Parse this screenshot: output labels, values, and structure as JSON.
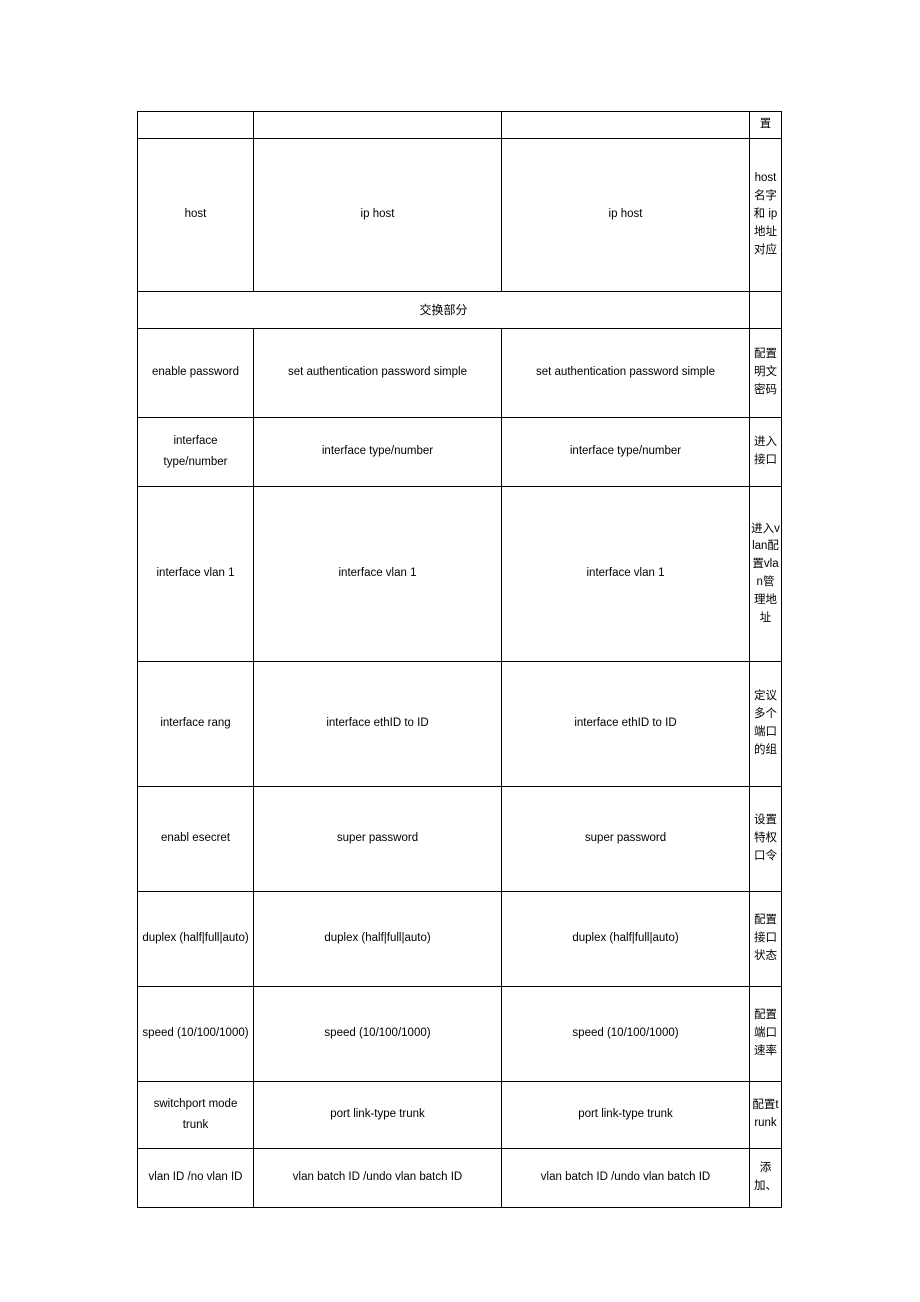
{
  "document": {
    "type": "command-comparison-table",
    "section_label": "交换部分"
  },
  "table": {
    "rows": [
      {
        "name": "partial-top-row",
        "cmd": "",
        "col2": "",
        "col3": "",
        "desc": "置"
      },
      {
        "name": "host-row",
        "cmd": "host",
        "col2": "ip host",
        "col3": "ip host",
        "desc": "host 名字和 ip 地址对应"
      },
      {
        "name": "section-divider",
        "section": true,
        "label": "交换部分"
      },
      {
        "name": "enable-password-row",
        "cmd": "enable password",
        "col2": "set authentication  password simple",
        "col3": "set authentication  password simple",
        "desc": "配置明文密码"
      },
      {
        "name": "interface-type-row",
        "cmd": "interface type/number",
        "col2": "interface type/number",
        "col3": "interface type/number",
        "desc": "进入接口"
      },
      {
        "name": "interface-vlan-row",
        "cmd": "interface vlan 1",
        "col2": "interface vlan 1",
        "col3": "interface vlan 1",
        "desc": "进入vlan配置vlan管理地址"
      },
      {
        "name": "interface-range-row",
        "cmd": "interface rang",
        "col2": "interface ethID to ID",
        "col3": "interface ethID to ID",
        "desc": "定议多个端口的组"
      },
      {
        "name": "enable-secret-row",
        "cmd": "enabl esecret",
        "col2": "super password",
        "col3": "super password",
        "desc": "设置特权口令"
      },
      {
        "name": "duplex-row",
        "cmd": "duplex (half|full|auto)",
        "col2": "duplex (half|full|auto)",
        "col3": "duplex (half|full|auto)",
        "desc": "配置接口状态"
      },
      {
        "name": "speed-row",
        "cmd": "speed (10/100/1000)",
        "col2": "speed (10/100/1000)",
        "col3": "speed (10/100/1000)",
        "desc": "配置端口速率"
      },
      {
        "name": "switchport-trunk-row",
        "cmd": "switchport mode trunk",
        "col2": "port link-type trunk",
        "col3": "port link-type trunk",
        "desc": "配置trunk"
      },
      {
        "name": "vlan-id-row",
        "cmd": "vlan ID /no vlan ID",
        "col2": "vlan batch ID /undo vlan batch ID",
        "col3": "vlan batch ID /undo vlan batch ID",
        "desc": "添加、"
      }
    ]
  }
}
